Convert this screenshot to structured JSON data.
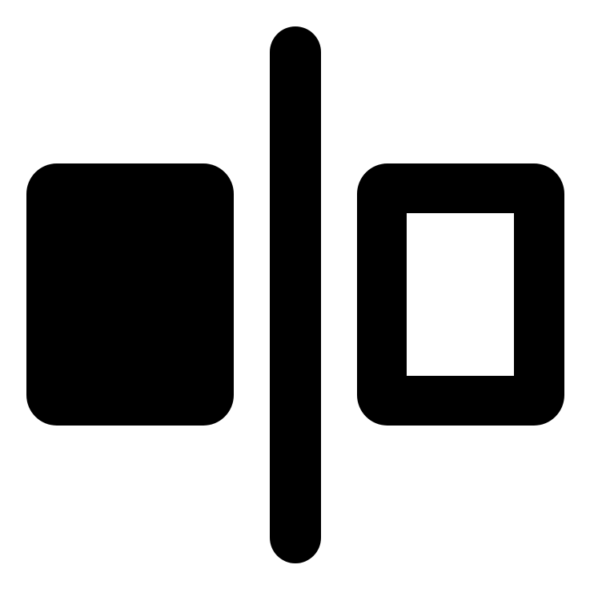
{
  "icon": {
    "name": "flip-horizontal-icon",
    "color": "#000000",
    "background": "#ffffff"
  }
}
